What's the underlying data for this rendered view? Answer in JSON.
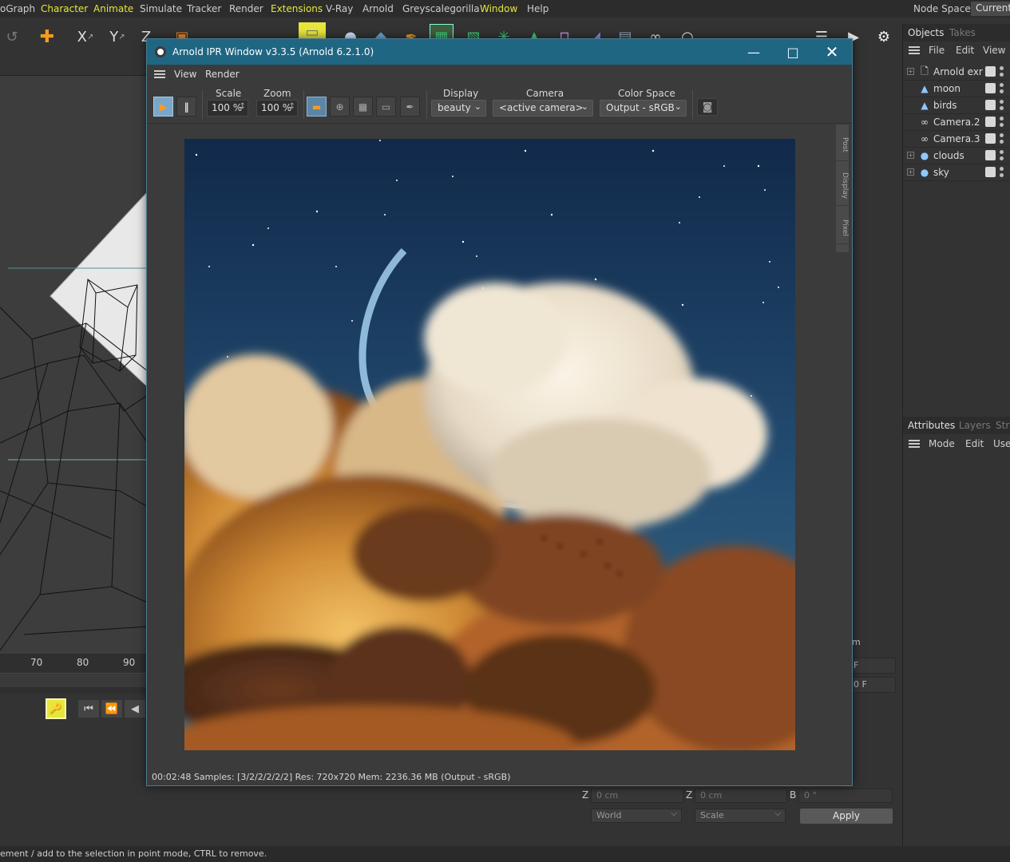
{
  "menubar": {
    "items": [
      "oGraph",
      "Character",
      "Animate",
      "Simulate",
      "Tracker",
      "Render",
      "Extensions",
      "V-Ray",
      "Arnold",
      "Greyscalegorilla",
      "Window",
      "Help"
    ],
    "node_space_label": "Node Space:",
    "node_space_value": "Current"
  },
  "toolbar": {
    "axis_x": "X",
    "axis_y": "Y",
    "axis_z": "Z"
  },
  "timeline": {
    "ticks": [
      "70",
      "80",
      "90"
    ]
  },
  "status": {
    "text": "ement / add to the selection in point mode, CTRL to remove."
  },
  "objects_panel": {
    "tabs": [
      "Objects",
      "Takes"
    ],
    "menu": [
      "File",
      "Edit",
      "View"
    ],
    "objects": [
      {
        "name": "Arnold exr",
        "icon": "document-icon",
        "expandable": true
      },
      {
        "name": "moon",
        "icon": "light-icon",
        "expandable": false
      },
      {
        "name": "birds",
        "icon": "light-icon",
        "expandable": false
      },
      {
        "name": "Camera.2",
        "icon": "camera-icon",
        "expandable": false
      },
      {
        "name": "Camera.3",
        "icon": "camera-icon",
        "expandable": false
      },
      {
        "name": "clouds",
        "icon": "null-object-icon",
        "expandable": true
      },
      {
        "name": "sky",
        "icon": "null-object-icon",
        "expandable": true
      }
    ]
  },
  "attributes_panel": {
    "tabs": [
      "Attributes",
      "Layers",
      "Stru"
    ],
    "menu": [
      "Mode",
      "Edit",
      "User"
    ]
  },
  "coordinates": {
    "z1_label": "Z",
    "z1_value": "0 cm",
    "z2_label": "Z",
    "z2_value": "0 cm",
    "b_label": "B",
    "b_value": "0 °",
    "world_select": "World",
    "scale_select": "Scale",
    "apply_label": "Apply",
    "frame_field_1": "F",
    "frame_field_2": "0 F",
    "viewport_hint": "m"
  },
  "ipr": {
    "title": "Arnold IPR Window v3.3.5 (Arnold 6.2.1.0)",
    "menu": [
      "View",
      "Render"
    ],
    "scale_label": "Scale",
    "scale_value": "100 %",
    "zoom_label": "Zoom",
    "zoom_value": "100 %",
    "display_label": "Display",
    "display_value": "beauty",
    "camera_label": "Camera",
    "camera_value": "<active camera>",
    "colorspace_label": "Color Space",
    "colorspace_value": "Output - sRGB",
    "side_tabs": [
      "Post",
      "Display",
      "Pixel"
    ],
    "status": "00:02:48  Samples: [3/2/2/2/2/2]  Res: 720x720  Mem: 2236.36 MB  (Output - sRGB)"
  },
  "colors": {
    "title_bar": "#1f6683",
    "accent_yellow": "#e6e63c",
    "sky_top": "#12294a",
    "cloud_warm": "#e3a341"
  }
}
